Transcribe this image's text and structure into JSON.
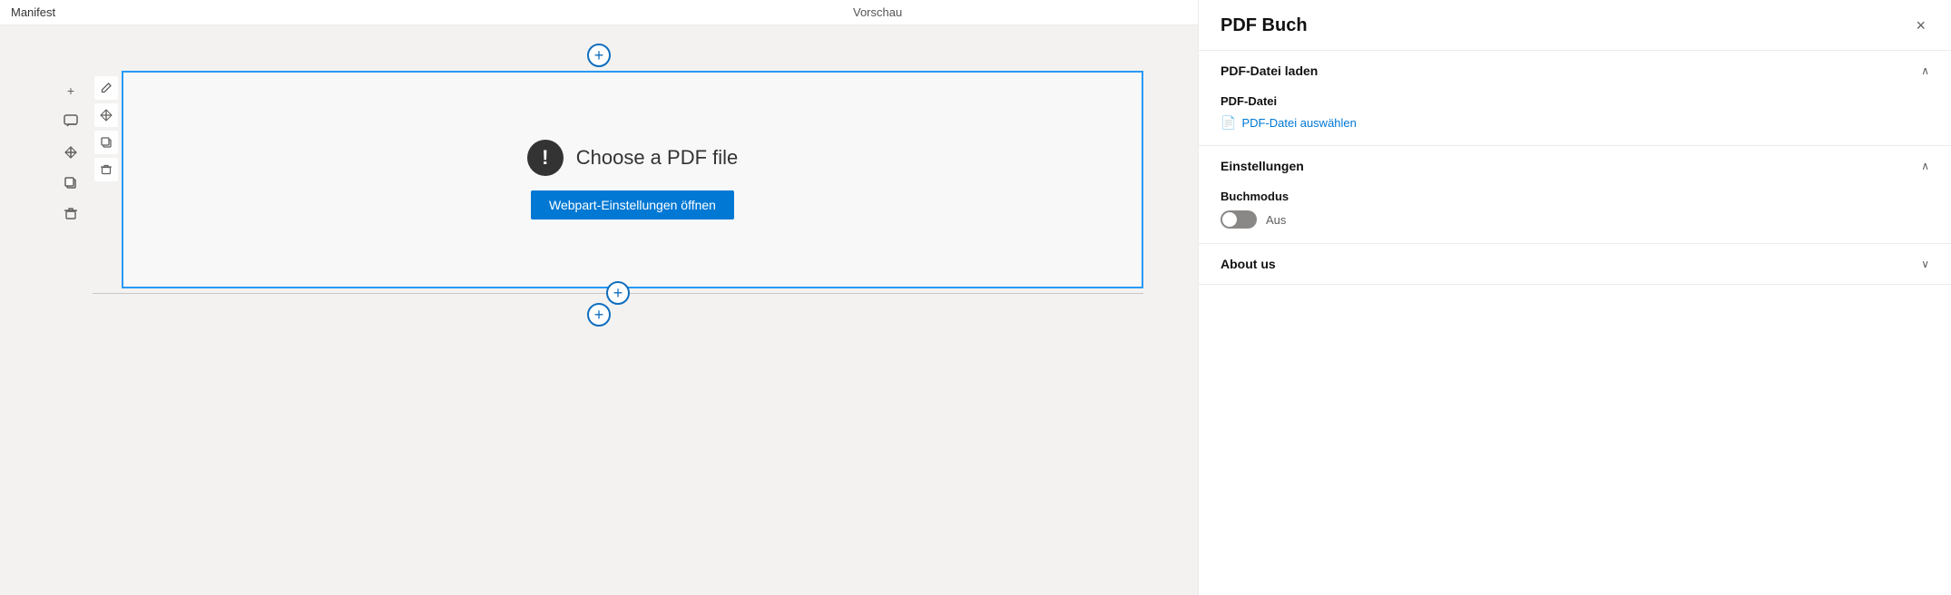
{
  "app": {
    "title": "Manifest"
  },
  "preview": {
    "label": "Vorschau"
  },
  "canvas": {
    "add_row_label": "+",
    "left_toolbar": [
      {
        "name": "add-section-icon",
        "icon": "+"
      },
      {
        "name": "comment-icon",
        "icon": "💬"
      },
      {
        "name": "move-icon",
        "icon": "⤢"
      },
      {
        "name": "copy-icon",
        "icon": "⧉"
      },
      {
        "name": "delete-icon",
        "icon": "🗑"
      }
    ],
    "inner_toolbar": [
      {
        "name": "edit-icon",
        "icon": "✏"
      },
      {
        "name": "move2-icon",
        "icon": "✥"
      },
      {
        "name": "duplicate-icon",
        "icon": "⧉"
      },
      {
        "name": "delete2-icon",
        "icon": "🗑"
      }
    ],
    "pdf_choose_text": "Choose a PDF file",
    "open_settings_btn": "Webpart-Einstellungen öffnen"
  },
  "right_panel": {
    "title": "PDF Buch",
    "close_btn_label": "×",
    "sections": {
      "load_pdf": {
        "title": "PDF-Datei laden",
        "expanded": true,
        "pdf_datei_label": "PDF-Datei",
        "select_link_text": "PDF-Datei auswählen"
      },
      "settings": {
        "title": "Einstellungen",
        "expanded": true,
        "buchmodus_label": "Buchmodus",
        "toggle_off_label": "Aus"
      },
      "about": {
        "title": "About us",
        "expanded": false
      }
    }
  }
}
